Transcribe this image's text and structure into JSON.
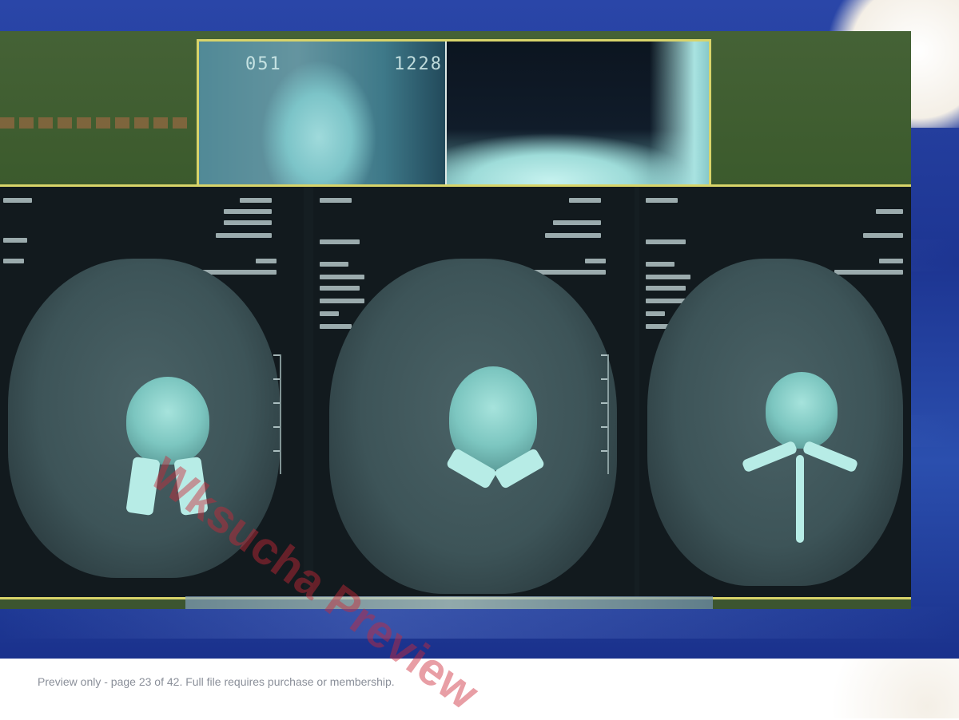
{
  "photo": {
    "description_alt": "CT scan films of spine on lightbox",
    "film_marks": {
      "left": "051",
      "right": "1228"
    }
  },
  "watermark": {
    "text": "Wksucha Preview"
  },
  "footer": {
    "preview_notice": "Preview only - page 23 of 42. Full file requires purchase or membership."
  },
  "colors": {
    "slide_background": "#2a46a8",
    "film_border": "#d8d46a",
    "watermark": "#cd2837",
    "footer_text": "#8a8f99"
  }
}
